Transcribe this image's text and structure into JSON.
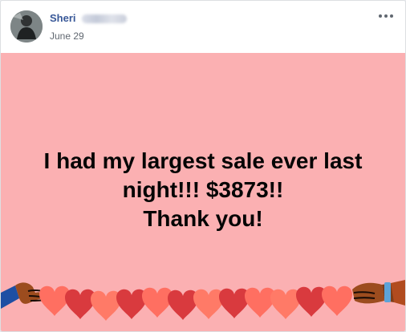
{
  "post": {
    "author": "Sheri",
    "date": "June 29",
    "more_icon": "ellipsis-icon",
    "message_lines": [
      "I had my largest sale ever last",
      "night!!! $3873!!",
      "Thank you!"
    ],
    "background_color": "#fbb0b2",
    "heart_colors": [
      "#ff6f61",
      "#d93a3e",
      "#ff7a67"
    ]
  }
}
